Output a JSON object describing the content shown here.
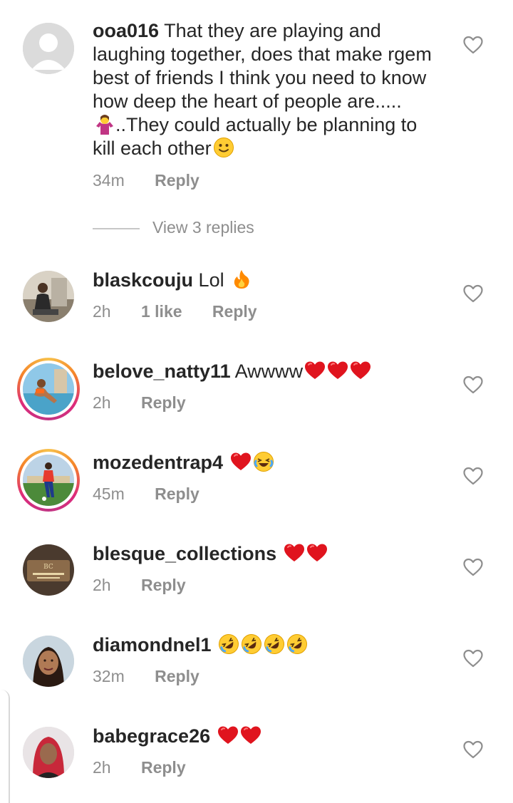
{
  "comments": [
    {
      "username": "ooa016",
      "text_lines": [
        " That they are playing and",
        "laughing together, does that make rgem",
        "best of friends  I think you need to know",
        "how deep the heart of people are.....",
        "..They could actually be planning to",
        "kill each other"
      ],
      "time": "34m",
      "reply": "Reply",
      "avatar": "default-profile-icon",
      "emoji": [
        "person-shrugging-emoji",
        "slightly-smiling-face-emoji"
      ]
    },
    {
      "username": "blaskcouju",
      "text": " Lol ",
      "time": "2h",
      "likes": "1 like",
      "reply": "Reply",
      "avatar": "man-seated-photo",
      "emoji": [
        "fire-emoji"
      ]
    },
    {
      "username": "belove_natty11",
      "text": " Awwww",
      "time": "2h",
      "reply": "Reply",
      "avatar": "woman-by-pool-photo",
      "story_ring": true,
      "emoji": [
        "red-heart-emoji",
        "red-heart-emoji",
        "red-heart-emoji"
      ]
    },
    {
      "username": "mozedentrap4",
      "text": " ",
      "time": "45m",
      "reply": "Reply",
      "avatar": "football-player-photo",
      "story_ring": true,
      "emoji": [
        "red-heart-emoji",
        "face-with-tears-of-joy-emoji"
      ]
    },
    {
      "username": "blesque_collections",
      "text": " ",
      "time": "2h",
      "reply": "Reply",
      "avatar": "store-sign-photo",
      "emoji": [
        "red-heart-emoji",
        "red-heart-emoji"
      ]
    },
    {
      "username": "diamondnel1",
      "text": " ",
      "time": "32m",
      "reply": "Reply",
      "avatar": "woman-portrait-photo",
      "emoji": [
        "rolling-on-floor-laughing-emoji",
        "rolling-on-floor-laughing-emoji",
        "rolling-on-floor-laughing-emoji",
        "rolling-on-floor-laughing-emoji"
      ]
    },
    {
      "username": "babegrace26",
      "text": " ",
      "time": "2h",
      "reply": "Reply",
      "avatar": "woman-red-hair-photo",
      "emoji": [
        "red-heart-emoji",
        "red-heart-emoji"
      ]
    }
  ],
  "view_replies": "View 3 replies",
  "colors": {
    "text": "#262626",
    "meta": "#8e8e8e",
    "heart_emoji": "#e0141e",
    "ring_start": "#f58529",
    "ring_end": "#dd2a7b"
  }
}
